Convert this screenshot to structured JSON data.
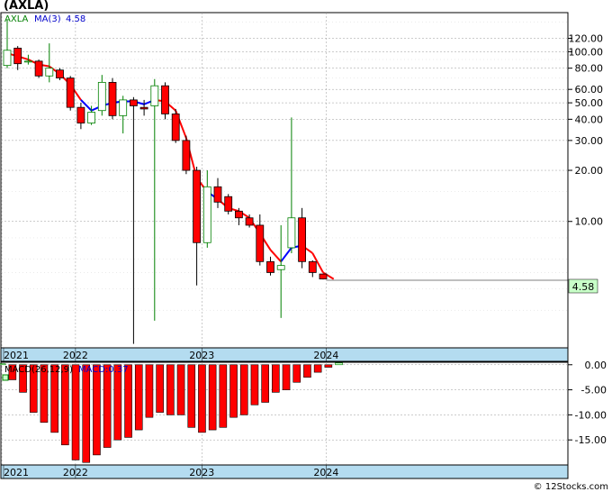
{
  "title": "(AXLA)",
  "watermark": "© 12Stocks.com",
  "colors": {
    "up": "#008000",
    "down": "#ff0000",
    "ma": "#ff0000",
    "ma_up": "#0000ff",
    "axis_band": "#b4dcf0",
    "last_price_bg": "#c8ffc8"
  },
  "chart_data": [
    {
      "type": "candlestick",
      "scale": "log",
      "legend": {
        "symbol": "AXLA",
        "ma_label": "MA(3)",
        "ma_value": "4.58"
      },
      "y_ticks": [
        "120.00",
        "100.00",
        "80.00",
        "60.00",
        "50.00",
        "40.00",
        "30.00",
        "20.00",
        "10.00"
      ],
      "y_tick_values": [
        120,
        100,
        80,
        60,
        50,
        40,
        30,
        20,
        10
      ],
      "ylim": [
        1.8,
        170
      ],
      "last_price": "4.58",
      "x_labels": [
        "2021",
        "2022",
        "2023",
        "2024"
      ],
      "x_label_index": [
        0,
        7,
        19,
        30.8
      ],
      "candles": [
        {
          "o": 83,
          "h": 155,
          "l": 80,
          "c": 102
        },
        {
          "o": 105,
          "h": 108,
          "l": 78,
          "c": 85
        },
        {
          "o": 88,
          "h": 96,
          "l": 84,
          "c": 88
        },
        {
          "o": 88,
          "h": 90,
          "l": 70,
          "c": 72
        },
        {
          "o": 72,
          "h": 112,
          "l": 66,
          "c": 80
        },
        {
          "o": 78,
          "h": 80,
          "l": 68,
          "c": 70
        },
        {
          "o": 70,
          "h": 72,
          "l": 45,
          "c": 47
        },
        {
          "o": 47,
          "h": 50,
          "l": 35,
          "c": 38
        },
        {
          "o": 38,
          "h": 48,
          "l": 37,
          "c": 44
        },
        {
          "o": 45,
          "h": 73,
          "l": 42,
          "c": 66
        },
        {
          "o": 66,
          "h": 70,
          "l": 40,
          "c": 42
        },
        {
          "o": 42,
          "h": 55,
          "l": 33,
          "c": 52
        },
        {
          "o": 52,
          "h": 54,
          "l": 1.9,
          "c": 48
        },
        {
          "o": 47,
          "h": 52,
          "l": 42,
          "c": 46
        },
        {
          "o": 48,
          "h": 69,
          "l": 2.6,
          "c": 63
        },
        {
          "o": 63,
          "h": 66,
          "l": 40,
          "c": 43
        },
        {
          "o": 43,
          "h": 46,
          "l": 29,
          "c": 30
        },
        {
          "o": 30,
          "h": 32,
          "l": 19,
          "c": 20
        },
        {
          "o": 20,
          "h": 21,
          "l": 4.2,
          "c": 7.5
        },
        {
          "o": 7.5,
          "h": 20,
          "l": 7.0,
          "c": 16
        },
        {
          "o": 16,
          "h": 18,
          "l": 12,
          "c": 13
        },
        {
          "o": 14,
          "h": 14.5,
          "l": 11,
          "c": 11.5
        },
        {
          "o": 11.5,
          "h": 12,
          "l": 9.5,
          "c": 10.5
        },
        {
          "o": 10.5,
          "h": 11,
          "l": 9.2,
          "c": 9.5
        },
        {
          "o": 9.5,
          "h": 11,
          "l": 5.5,
          "c": 5.8
        },
        {
          "o": 5.8,
          "h": 6.2,
          "l": 4.8,
          "c": 5.0
        },
        {
          "o": 5.2,
          "h": 9.5,
          "l": 2.7,
          "c": 5.5
        },
        {
          "o": 7.0,
          "h": 41,
          "l": 6.5,
          "c": 10.5
        },
        {
          "o": 10.5,
          "h": 12,
          "l": 5.3,
          "c": 5.8
        },
        {
          "o": 5.8,
          "h": 5.9,
          "l": 4.7,
          "c": 5.0
        },
        {
          "o": 4.9,
          "h": 4.9,
          "l": 4.55,
          "c": 4.58
        }
      ],
      "ma3": [
        98,
        94,
        90,
        84,
        82,
        74,
        64,
        52,
        45,
        48,
        50,
        51,
        51,
        49,
        52,
        51,
        45,
        31,
        18,
        15,
        13.5,
        12,
        11.5,
        10.5,
        8.5,
        6.8,
        5.8,
        7.0,
        7.2,
        6.5,
        5.0,
        4.58
      ],
      "ma3_dir": [
        0,
        0,
        0,
        0,
        0,
        0,
        0,
        0,
        1,
        1,
        1,
        1,
        1,
        1,
        1,
        0,
        0,
        0,
        0,
        0,
        1,
        0,
        0,
        0,
        0,
        0,
        0,
        1,
        1,
        0,
        0,
        0
      ]
    },
    {
      "type": "bar",
      "legend": {
        "label": "MACD(26,12,9)",
        "value_label": "MACD:0.37"
      },
      "y_ticks": [
        "0.00",
        "-5.00",
        "-10.00",
        "-15.00"
      ],
      "y_tick_values": [
        0,
        -5,
        -10,
        -15
      ],
      "ylim": [
        -20,
        0.5
      ],
      "x_labels": [
        "2021",
        "2022",
        "2023",
        "2024"
      ],
      "values": [
        0.2,
        -3.0,
        -5.5,
        -9.5,
        -11.5,
        -13.5,
        -16.0,
        -19.0,
        -19.5,
        -18.0,
        -16.5,
        -15.0,
        -14.5,
        -13.0,
        -10.5,
        -9.5,
        -10.0,
        -10.0,
        -12.5,
        -13.5,
        -13.0,
        -12.5,
        -10.5,
        -10.0,
        -8.0,
        -7.5,
        -5.5,
        -5.0,
        -3.5,
        -2.5,
        -1.5,
        -0.5,
        0.37
      ]
    }
  ]
}
